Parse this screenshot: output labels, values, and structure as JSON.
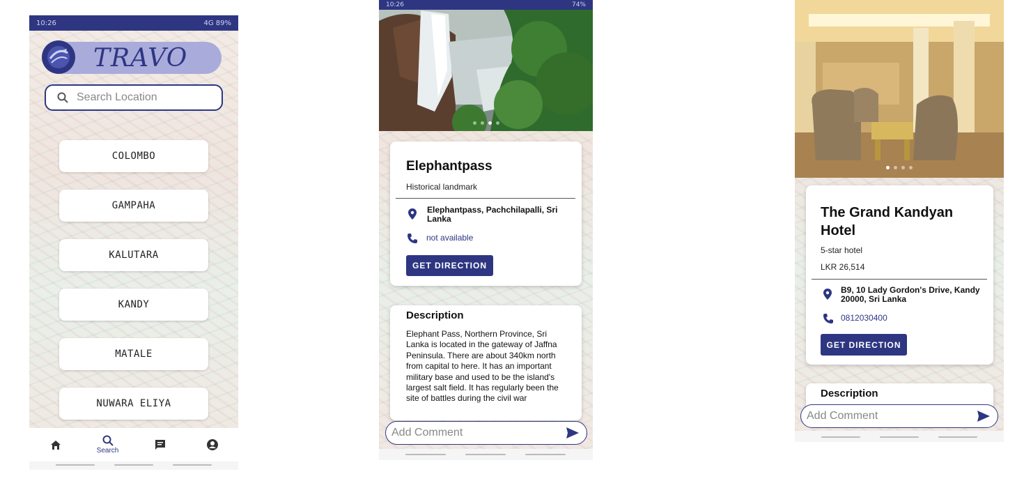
{
  "colors": {
    "primary": "#2e3682",
    "pill": "#a9abdb",
    "white": "#ffffff"
  },
  "screen1": {
    "status": {
      "time": "10:26",
      "right": "4G 89%"
    },
    "logo_text": "TRAVO",
    "search": {
      "placeholder": "Search Location"
    },
    "cities": [
      "COLOMBO",
      "GAMPAHA",
      "KALUTARA",
      "KANDY",
      "MATALE",
      "NUWARA ELIYA"
    ],
    "nav": {
      "home_icon": "home-icon",
      "search_label": "Search",
      "chat_icon": "chat-icon",
      "account_icon": "account-icon"
    }
  },
  "screen2": {
    "status": {
      "time": "10:26",
      "right": "74%"
    },
    "title": "Elephantpass",
    "category": "Historical landmark",
    "address": "Elephantpass, Pachchilapalli, Sri Lanka",
    "phone": "not available",
    "direction_label": "GET DIRECTION",
    "description_title": "Description",
    "description": "Elephant Pass, Northern Province, Sri Lanka is located in the gateway of Jaffna Peninsula. There are about 340km north from capital to here. It has an important military base and used to be the island's largest salt field. It has regularly been the site of battles during the civil war",
    "comment_placeholder": "Add Comment"
  },
  "screen3": {
    "title": "The Grand Kandyan Hotel",
    "category": "5-star hotel",
    "price": "LKR 26,514",
    "address": "B9, 10 Lady Gordon's Drive, Kandy 20000, Sri Lanka",
    "phone": "0812030400",
    "direction_label": "GET DIRECTION",
    "description_title": "Description",
    "comment_placeholder": "Add Comment"
  }
}
